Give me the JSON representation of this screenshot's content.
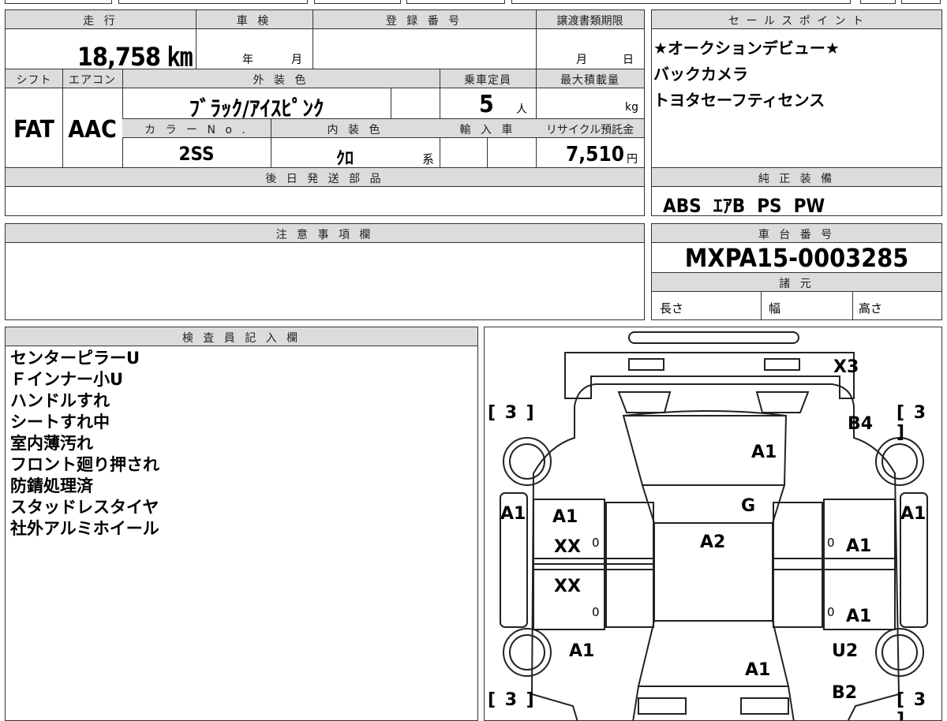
{
  "labels": {
    "mileage": "走 行",
    "inspection": "車 検",
    "registration": "登 録 番 号",
    "transfer_deadline": "譲渡書類期限",
    "sales_point": "セ ー ル ス ポ イ ン ト",
    "shift": "シフト",
    "aircon": "エアコン",
    "exterior_color": "外 装 色",
    "capacity": "乗車定員",
    "max_load": "最大積載量",
    "color_no": "カ ラ ー N o .",
    "interior_color": "内 装 色",
    "import": "輸 入 車",
    "recycle": "リサイクル預託金",
    "later_parts": "後 日 発 送 部 品",
    "genuine_equipment": "純 正 装 備",
    "caution": "注 意 事 項 欄",
    "chassis_no": "車 台 番 号",
    "specs": "諸 元",
    "length": "長さ",
    "width": "幅",
    "height": "高さ",
    "inspector": "検 査 員 記 入 欄",
    "year": "年",
    "month": "月",
    "month2": "月",
    "day": "日",
    "person": "人",
    "kg": "kg",
    "yen": "円",
    "kei": "系"
  },
  "values": {
    "mileage": "18,758 ㎞",
    "shift": "FAT",
    "aircon": "AAC",
    "exterior_color": "ﾌﾞﾗｯｸ/ｱｲｽﾋﾟﾝｸ",
    "capacity": "5",
    "color_no": "2SS",
    "interior_color": "ｸﾛ",
    "recycle": "7,510"
  },
  "sales_points": [
    "★オークションデビュー★",
    "バックカメラ",
    "トヨタセーフティセンス"
  ],
  "genuine_equipment": "ABS  ｴｱB  PS  PW",
  "chassis_no": "MXPA15-0003285",
  "inspector_notes": [
    "センターピラーU",
    "Ｆインナー小U",
    "ハンドルすれ",
    "シートすれ中",
    "室内薄汚れ",
    "フロント廻り押され",
    "防錆処理済",
    "スタッドレスタイヤ",
    "社外アルミホイール"
  ],
  "diagram": {
    "marks": {
      "x3": "X3",
      "b4": "B4",
      "a1_hood": "A1",
      "g_windshield": "G",
      "a1_left_fender": "A1",
      "a1_right_fender": "A1",
      "a1_front_left_door": "A1",
      "xx_front_left_door": "XX",
      "a2_roof": "A2",
      "a1_front_right_door": "A1",
      "xx_rear_left_door": "XX",
      "a1_rear_right_door": "A1",
      "a1_left_quarter": "A1",
      "u2": "U2",
      "a1_trunk": "A1",
      "b2": "B2",
      "zero_fl": "0",
      "zero_rl": "0",
      "zero_fr": "0",
      "zero_rr": "0"
    },
    "tire_fl": "[ 3 ]",
    "tire_fr": "[ 3 ]",
    "tire_rl": "[ 3 ]",
    "tire_rr": "[ 3 ]"
  }
}
